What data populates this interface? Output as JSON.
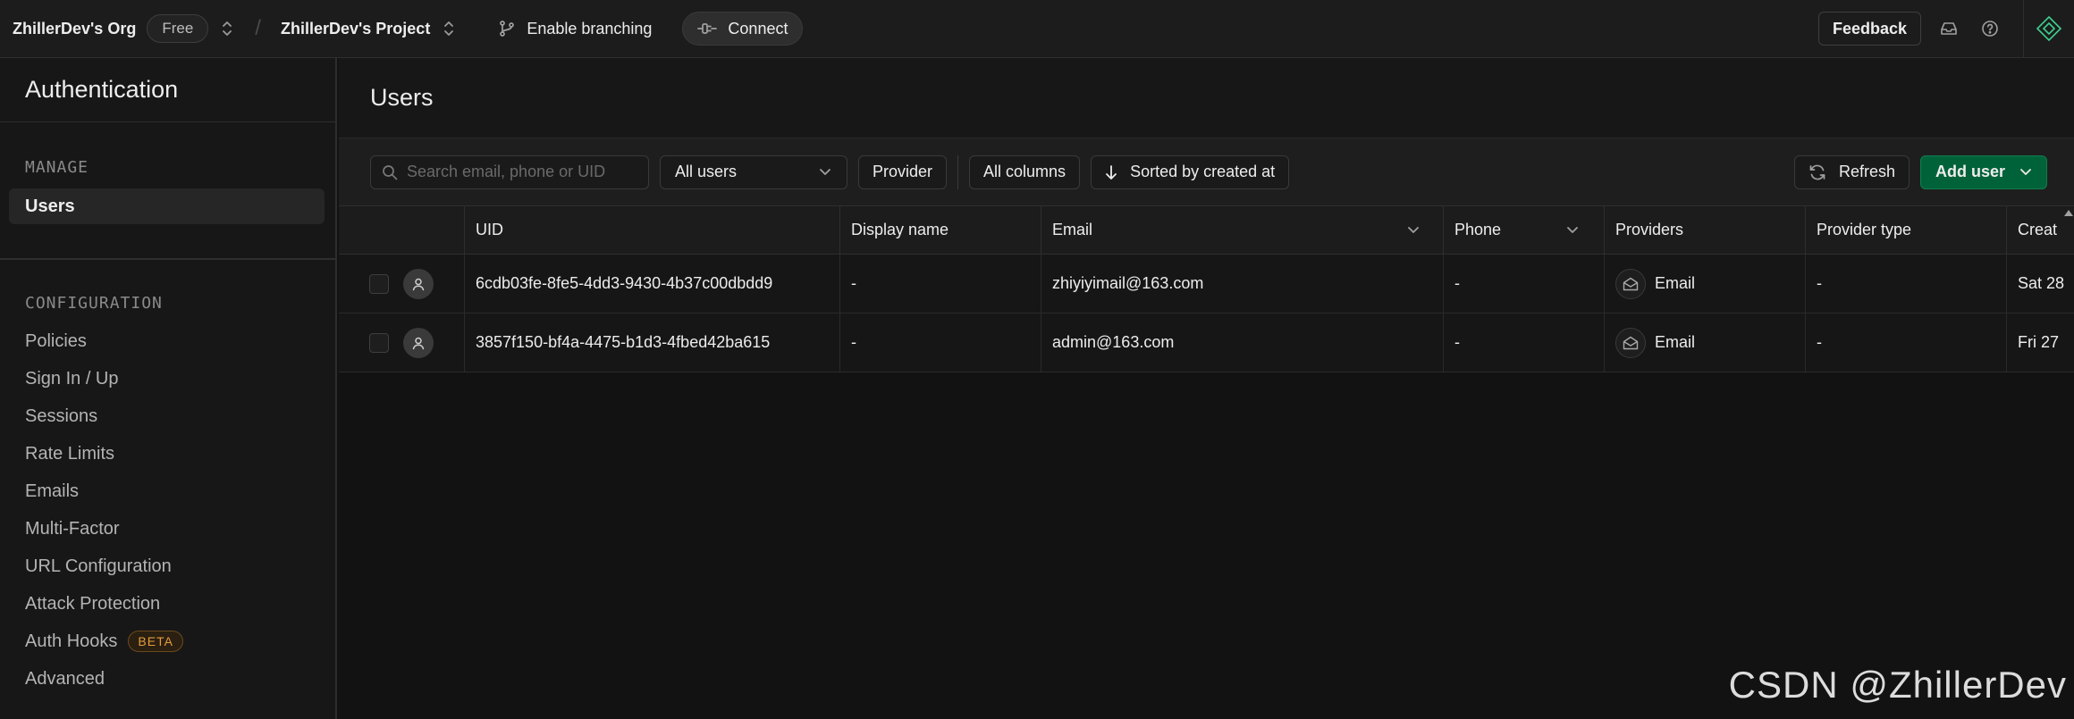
{
  "topbar": {
    "org": "ZhillerDev's Org",
    "plan": "Free",
    "separator": "/",
    "project": "ZhillerDev's Project",
    "branching_label": "Enable branching",
    "connect_label": "Connect",
    "feedback_label": "Feedback",
    "icons": {
      "inbox": "inbox-icon",
      "help": "help-icon",
      "logo": "diamond-logo-icon"
    }
  },
  "sidebar": {
    "title": "Authentication",
    "manage_heading": "MANAGE",
    "manage_items": [
      {
        "label": "Users",
        "active": true
      }
    ],
    "config_heading": "CONFIGURATION",
    "config_items": [
      {
        "label": "Policies"
      },
      {
        "label": "Sign In / Up"
      },
      {
        "label": "Sessions"
      },
      {
        "label": "Rate Limits"
      },
      {
        "label": "Emails"
      },
      {
        "label": "Multi-Factor"
      },
      {
        "label": "URL Configuration"
      },
      {
        "label": "Attack Protection"
      },
      {
        "label": "Auth Hooks",
        "badge": "BETA"
      },
      {
        "label": "Advanced"
      }
    ]
  },
  "main": {
    "title": "Users",
    "toolbar": {
      "search_placeholder": "Search email, phone or UID",
      "filter_value": "All users",
      "provider_label": "Provider",
      "columns_label": "All columns",
      "sort_label": "Sorted by created at",
      "refresh_label": "Refresh",
      "add_user_label": "Add user"
    },
    "table": {
      "headers": [
        "UID",
        "Display name",
        "Email",
        "Phone",
        "Providers",
        "Provider type",
        "Creat"
      ],
      "rows": [
        {
          "uid": "6cdb03fe-8fe5-4dd3-9430-4b37c00dbdd9",
          "display_name": "-",
          "email": "zhiyiyimail@163.com",
          "phone": "-",
          "provider": "Email",
          "provider_type": "-",
          "created": "Sat 28"
        },
        {
          "uid": "3857f150-bf4a-4475-b1d3-4fbed42ba615",
          "display_name": "-",
          "email": "admin@163.com",
          "phone": "-",
          "provider": "Email",
          "provider_type": "-",
          "created": "Fri 27"
        }
      ]
    }
  },
  "watermark": "CSDN @ZhillerDev",
  "colors": {
    "accent_green": "#006239",
    "logo_green": "#3ecf8e",
    "beta_orange": "#e49b3e",
    "background": "#121212"
  }
}
